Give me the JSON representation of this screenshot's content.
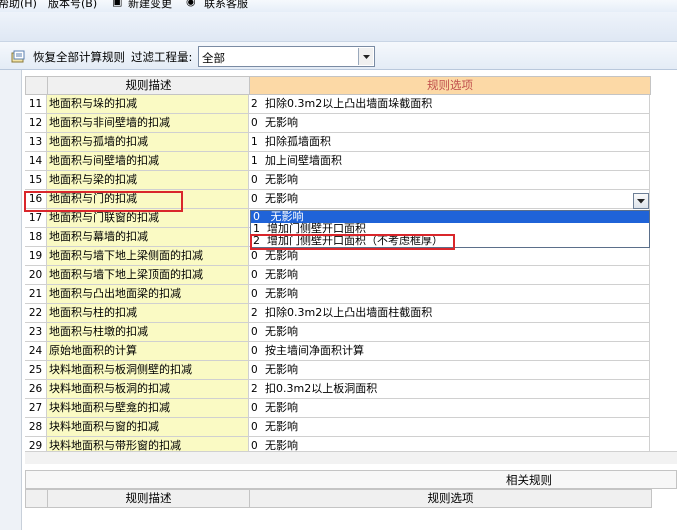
{
  "menubar": {
    "items": [
      {
        "label": "帮助(H)"
      },
      {
        "label": "版本号(B)"
      },
      {
        "label": "新建变更"
      },
      {
        "label": "联系客服"
      }
    ]
  },
  "toolbar": {
    "restore_label": "恢复全部计算规则",
    "filter_label": "过滤工程量:",
    "filter_value": "全部"
  },
  "grid": {
    "headers": {
      "description": "规则描述",
      "option": "规则选项"
    },
    "rows": [
      {
        "num": "11",
        "desc": "地面积与垛的扣减",
        "code": "2",
        "opt": "扣除0.3m2以上凸出墙面垛截面积"
      },
      {
        "num": "12",
        "desc": "地面积与非间壁墙的扣减",
        "code": "0",
        "opt": "无影响"
      },
      {
        "num": "13",
        "desc": "地面积与孤墙的扣减",
        "code": "1",
        "opt": "扣除孤墙面积"
      },
      {
        "num": "14",
        "desc": "地面积与间壁墙的扣减",
        "code": "1",
        "opt": "加上间壁墙面积"
      },
      {
        "num": "15",
        "desc": "地面积与梁的扣减",
        "code": "0",
        "opt": "无影响"
      },
      {
        "num": "16",
        "desc": "地面积与门的扣减",
        "code": "0",
        "opt": "无影响"
      },
      {
        "num": "17",
        "desc": "地面积与门联窗的扣减",
        "code": "",
        "opt": ""
      },
      {
        "num": "18",
        "desc": "地面积与幕墙的扣减",
        "code": "",
        "opt": ""
      },
      {
        "num": "19",
        "desc": "地面积与墙下地上梁侧面的扣减",
        "code": "0",
        "opt": "无影响"
      },
      {
        "num": "20",
        "desc": "地面积与墙下地上梁顶面的扣减",
        "code": "0",
        "opt": "无影响"
      },
      {
        "num": "21",
        "desc": "地面积与凸出地面梁的扣减",
        "code": "0",
        "opt": "无影响"
      },
      {
        "num": "22",
        "desc": "地面积与柱的扣减",
        "code": "2",
        "opt": "扣除0.3m2以上凸出墙面柱截面积"
      },
      {
        "num": "23",
        "desc": "地面积与柱墩的扣减",
        "code": "0",
        "opt": "无影响"
      },
      {
        "num": "24",
        "desc": "原始地面积的计算",
        "code": "0",
        "opt": "按主墙间净面积计算"
      },
      {
        "num": "25",
        "desc": "块料地面积与板洞侧壁的扣减",
        "code": "0",
        "opt": "无影响"
      },
      {
        "num": "26",
        "desc": "块料地面积与板洞的扣减",
        "code": "2",
        "opt": "扣0.3m2以上板洞面积"
      },
      {
        "num": "27",
        "desc": "块料地面积与壁龛的扣减",
        "code": "0",
        "opt": "无影响"
      },
      {
        "num": "28",
        "desc": "块料地面积与窗的扣减",
        "code": "0",
        "opt": "无影响"
      },
      {
        "num": "29",
        "desc": "块料地面积与带形窗的扣减",
        "code": "0",
        "opt": "无影响"
      }
    ],
    "dropdown": {
      "items": [
        {
          "code": "0",
          "label": "无影响"
        },
        {
          "code": "1",
          "label": "增加门侧壁开口面积"
        },
        {
          "code": "2",
          "label": "增加门侧壁开口面积（不考虑框厚）"
        }
      ]
    }
  },
  "related": {
    "title": "相关规则",
    "headers": {
      "description": "规则描述",
      "option": "规则选项"
    }
  },
  "colors": {
    "desc_cell_bg": "#fafac4",
    "header_selected_bg": "#fcd9a6",
    "highlight_red": "#d9262b",
    "dropdown_selected_bg": "#1f63d8"
  }
}
